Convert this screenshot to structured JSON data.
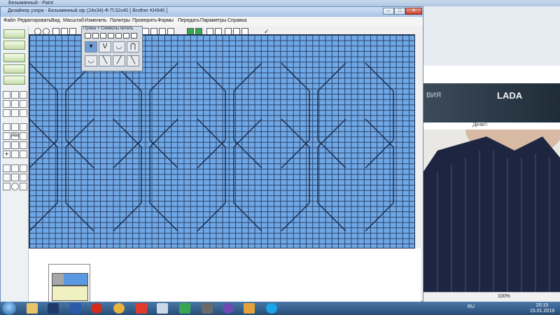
{
  "paint_window": {
    "title": "Безымянный - Paint"
  },
  "designer": {
    "title": "Дизайнер узора - Безымянный.stp (24x34)-Ф     П:32х40     [ Brother KH940 ]",
    "window_controls": {
      "minimize": "–",
      "maximize": "□",
      "close": "✕"
    },
    "menu": [
      "Файл",
      "Редактировать",
      "Вид",
      "Масштаб",
      "Изменить",
      "Палитры",
      "Проверить",
      "Формы",
      "Передать",
      "Параметры",
      "Справка"
    ],
    "palette": {
      "title": "Пряжа + Символы петель",
      "symbols": [
        "▾",
        "V",
        "◡",
        "⋂",
        "◡",
        "╲",
        "╱",
        "╲"
      ]
    },
    "colors": {
      "grid_fill": "#6fa8e6",
      "grid_line": "#2a3f66",
      "preview_yarn": "#f1f0c0"
    }
  },
  "browser": {
    "banner_word": "ВИЯ",
    "banner_brand": "LADA",
    "caption": "Дело\\\\",
    "zoom": "100%"
  },
  "taskbar": {
    "language": "RU",
    "time": "20:15",
    "date": "15.01.2019"
  }
}
